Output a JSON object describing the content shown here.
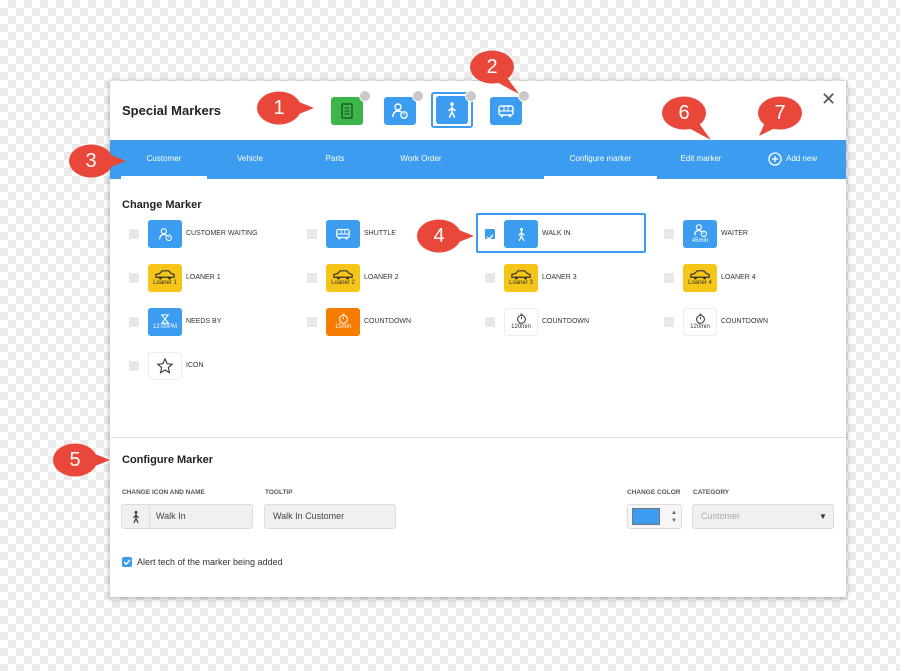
{
  "dialog": {
    "title": "Special Markers",
    "close": "✕"
  },
  "tabs": {
    "customer": "Customer",
    "vehicle": "Vehicle",
    "parts": "Parts",
    "work_order": "Work Order",
    "configure_marker": "Configure marker",
    "edit_marker": "Edit marker",
    "add_new": "Add new"
  },
  "change_marker": {
    "title": "Change Marker",
    "markers": [
      {
        "label": "CUSTOMER WAITING",
        "icon": "person-clock-icon",
        "color": "#3b9cf0"
      },
      {
        "label": "SHUTTLE",
        "icon": "bus-icon",
        "color": "#3b9cf0"
      },
      {
        "label": "WALK IN",
        "icon": "walking-person-icon",
        "color": "#3b9cf0",
        "checked": true
      },
      {
        "label": "WAITER",
        "icon": "person-clock-icon",
        "sub": "45min",
        "color": "#3b9cf0"
      },
      {
        "label": "LOANER 1",
        "icon": "car-icon",
        "sub": "Loaner 1",
        "color": "#f5c518"
      },
      {
        "label": "LOANER 2",
        "icon": "car-icon",
        "sub": "Loaner 2",
        "color": "#f5c518"
      },
      {
        "label": "LOANER 3",
        "icon": "car-icon",
        "sub": "Loaner 3",
        "color": "#f5c518"
      },
      {
        "label": "LOANER 4",
        "icon": "car-icon",
        "sub": "Loaner 4",
        "color": "#f5c518"
      },
      {
        "label": "NEEDS BY",
        "icon": "hourglass-icon",
        "sub": "12:00PM",
        "color": "#3b9cf0"
      },
      {
        "label": "COUNTDOWN",
        "icon": "stopwatch-icon",
        "sub": "15min",
        "color": "#f57c00"
      },
      {
        "label": "COUNTDOWN",
        "icon": "stopwatch-icon",
        "sub": "120min",
        "color": "#ffffff"
      },
      {
        "label": "COUNTDOWN",
        "icon": "stopwatch-icon",
        "sub": "120min",
        "color": "#ffffff"
      },
      {
        "label": "ICON",
        "icon": "star-icon",
        "color": "#ffffff"
      }
    ]
  },
  "configure": {
    "title": "Configure Marker",
    "icon_name_label": "CHANGE ICON AND NAME",
    "icon_name_value": "Walk In",
    "tooltip_label": "TOOLTIP",
    "tooltip_value": "Walk In Customer",
    "color_label": "CHANGE COLOR",
    "color_value": "#3b9cf0",
    "category_label": "CATEGORY",
    "category_value": "Customer",
    "alert_label": "Alert tech of the marker being added",
    "alert_checked": true
  },
  "callouts": [
    "1",
    "2",
    "3",
    "4",
    "5",
    "6",
    "7"
  ],
  "colors": {
    "accent": "#3b9cf0",
    "callout": "#e8473a",
    "green": "#3cb54a"
  }
}
